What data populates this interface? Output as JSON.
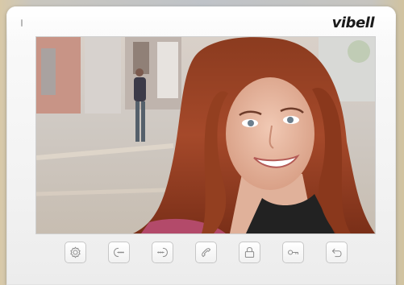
{
  "brand": {
    "logo_text": "vibell"
  },
  "screen": {
    "image_subject": "camera-feed"
  },
  "controls": [
    {
      "icon": "settings-icon",
      "name": "settings-button"
    },
    {
      "icon": "call-in-icon",
      "name": "monitor-button"
    },
    {
      "icon": "call-out-icon",
      "name": "transfer-button"
    },
    {
      "icon": "handset-icon",
      "name": "talk-button"
    },
    {
      "icon": "lock-icon",
      "name": "unlock-door-button"
    },
    {
      "icon": "key-icon",
      "name": "unlock-gate-button"
    },
    {
      "icon": "return-icon",
      "name": "back-button"
    }
  ],
  "colors": {
    "panel": "#f5f5f5",
    "icon": "#8d8d8d",
    "logo": "#1a1a1a"
  }
}
